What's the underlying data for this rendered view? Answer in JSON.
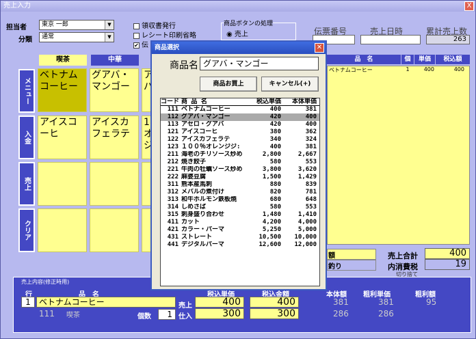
{
  "window": {
    "title": "売上入力",
    "close": "X"
  },
  "header": {
    "staff_label": "担当者",
    "staff_value": "東京 一郎",
    "category_label": "分類",
    "category_value": "通常",
    "chk1": "領収書発行",
    "chk2": "レシート印刷省略",
    "chk3": "伝",
    "group_label": "商品ボタンの処理",
    "radio_label": "売上",
    "slip_label": "伝票番号",
    "date_label": "売上日時",
    "cum_label": "累計売上数",
    "cum_value": "263"
  },
  "categories": [
    "喫茶",
    "中華"
  ],
  "side_buttons": [
    "メニュー",
    "入金",
    "売上",
    "クリア"
  ],
  "menu_cells": [
    [
      "ベトナムコーヒー",
      "グアバ・マンゴー",
      "アイ\nパ"
    ],
    [
      "アイスコーヒ",
      "アイスカフェラテ",
      "1\nオ\nジ"
    ]
  ],
  "cart": {
    "headers": [
      "品　名",
      "個",
      "単価",
      "税込額"
    ],
    "rows": [
      [
        "ベトナムコーヒー",
        "1",
        "400",
        "400"
      ]
    ]
  },
  "totals": {
    "amount_label": "額",
    "change_label": "釣り",
    "subtotal_label": "売上合計",
    "subtotal_value": "400",
    "tax_label": "内消費税",
    "tax_value": "19",
    "round_note": "切り捨て"
  },
  "dialog": {
    "title": "商品選択",
    "name_label": "商品名",
    "name_value": "グアバ・マンゴー",
    "buy_button": "商品お買上",
    "cancel_button": "キャンセル(+)",
    "headers": [
      "コード",
      "商 品 名",
      "税込単価",
      "本体単価"
    ],
    "items": [
      [
        "111",
        "ベトナムコーヒー",
        "400",
        "381"
      ],
      [
        "112",
        "グアバ・マンゴー",
        "420",
        "400"
      ],
      [
        "113",
        "アセロ・グアバ",
        "420",
        "400"
      ],
      [
        "121",
        "アイスコーヒ",
        "380",
        "362"
      ],
      [
        "122",
        "アイスカフェラテ",
        "340",
        "324"
      ],
      [
        "123",
        "１００％オレンジジ:",
        "400",
        "381"
      ],
      [
        "211",
        "海老のチリソース炒め",
        "2,800",
        "2,667"
      ],
      [
        "212",
        "焼き餃子",
        "580",
        "553"
      ],
      [
        "221",
        "牛肉の牡蠣ソース炒め",
        "3,800",
        "3,620"
      ],
      [
        "222",
        "麻婆豆腐",
        "1,500",
        "1,429"
      ],
      [
        "311",
        "熊本産馬刺",
        "880",
        "839"
      ],
      [
        "312",
        "メバルの煮付け",
        "820",
        "781"
      ],
      [
        "313",
        "和牛ホルモン鉄板焼",
        "680",
        "648"
      ],
      [
        "314",
        "しめさば",
        "580",
        "553"
      ],
      [
        "315",
        "刺身盛り合わせ",
        "1,480",
        "1,410"
      ],
      [
        "411",
        "カット",
        "4,200",
        "4,000"
      ],
      [
        "421",
        "カラー・パーマ",
        "5,250",
        "5,000"
      ],
      [
        "431",
        "ストレート",
        "10,500",
        "10,000"
      ],
      [
        "441",
        "デジタルパーマ",
        "12,600",
        "12,000"
      ]
    ],
    "selected_index": 1
  },
  "detail": {
    "section_label": "売上内容(修正時用)",
    "row_label": "行",
    "name_label": "品　名",
    "row_value": "1",
    "name_value": "ベトナムコーヒー",
    "code": "111",
    "category": "喫茶",
    "qty_label": "個数",
    "qty_value": "1",
    "sales_label": "売上",
    "stock_label": "仕入",
    "taxunit_label": "税込単価",
    "taxtotal_label": "税込金額",
    "sales_unit": "400",
    "sales_total": "400",
    "stock_unit": "300",
    "stock_total": "300",
    "base_label": "本体額",
    "gross_unit_label": "粗利単価",
    "gross_label": "粗利額",
    "base_sales": "381",
    "gross_unit_sales": "381",
    "gross_sales": "95",
    "base_stock": "286",
    "gross_unit_stock": "286"
  }
}
